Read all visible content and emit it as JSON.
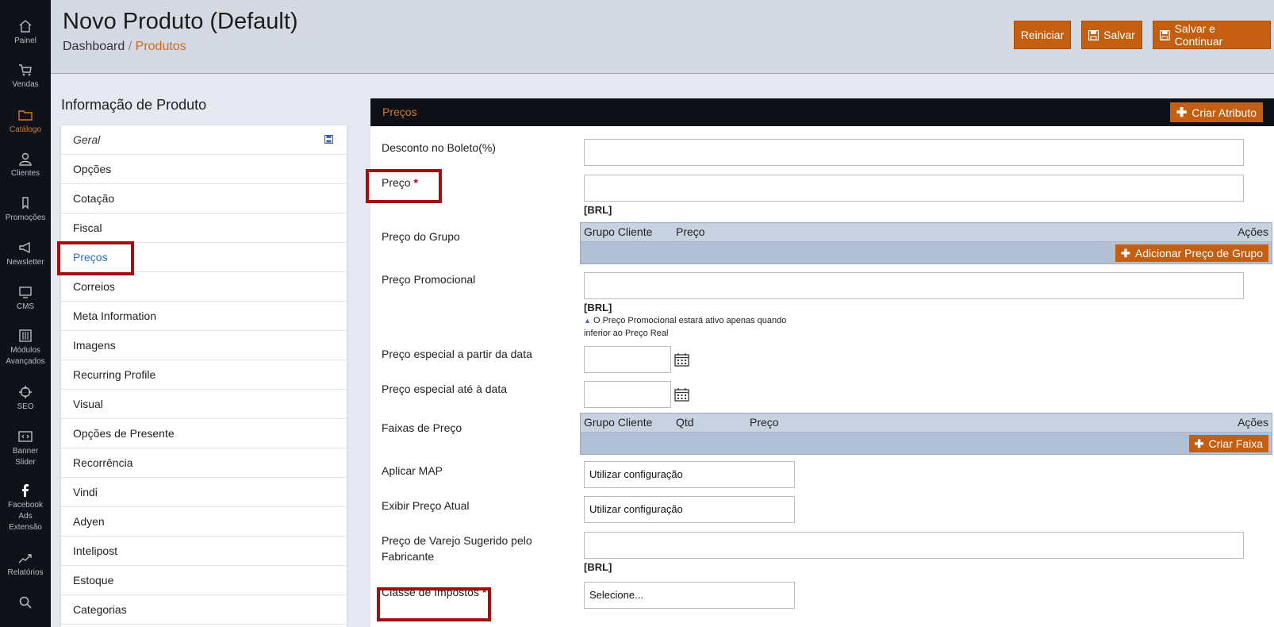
{
  "nav": [
    {
      "label": "Painel",
      "icon": "home-icon"
    },
    {
      "label": "Vendas",
      "icon": "cart-icon"
    },
    {
      "label": "Catálogo",
      "icon": "folder-icon",
      "active": true
    },
    {
      "label": "Clientes",
      "icon": "user-icon"
    },
    {
      "label": "Promoções",
      "icon": "tag-icon"
    },
    {
      "label": "Newsletter",
      "icon": "megaphone-icon"
    },
    {
      "label": "CMS",
      "icon": "monitor-icon"
    },
    {
      "label": "Módulos Avançados",
      "icon": "sliders-icon"
    },
    {
      "label": "SEO",
      "icon": "crosshair-icon"
    },
    {
      "label": "Banner Slider",
      "icon": "code-icon"
    },
    {
      "label": "Facebook Ads Extensão",
      "icon": "facebook-icon"
    },
    {
      "label": "Relatórios",
      "icon": "chart-icon"
    },
    {
      "label": "",
      "icon": "search-icon"
    }
  ],
  "header": {
    "title": "Novo Produto (Default)",
    "breadcrumb_home": "Dashboard",
    "breadcrumb_sep": "/",
    "breadcrumb_current": "Produtos",
    "reset_label": "Reiniciar",
    "save_label": "Salvar",
    "save_continue_label": "Salvar e Continuar"
  },
  "sidebar": {
    "title": "Informação de Produto",
    "tabs": [
      "Geral",
      "Opções",
      "Cotação",
      "Fiscal",
      "Preços",
      "Correios",
      "Meta Information",
      "Imagens",
      "Recurring Profile",
      "Visual",
      "Opções de Presente",
      "Recorrência",
      "Vindi",
      "Adyen",
      "Intelipost",
      "Estoque",
      "Categorias"
    ],
    "active_tab": "Preços"
  },
  "main": {
    "section_title": "Preços",
    "create_attribute_label": "Criar Atributo",
    "currency": "[BRL]",
    "fields": {
      "boleto_discount": {
        "label": "Desconto no Boleto(%)",
        "value": ""
      },
      "price": {
        "label": "Preço",
        "required": "*",
        "value": ""
      },
      "group_price": {
        "label": "Preço do Grupo",
        "col_group": "Grupo Cliente",
        "col_price": "Preço",
        "col_actions": "Ações",
        "add_label": "Adicionar Preço de Grupo"
      },
      "special_price": {
        "label": "Preço Promocional",
        "value": "",
        "note": "O Preço Promocional estará ativo apenas quando inferior ao Preço Real"
      },
      "special_from": {
        "label": "Preço especial a partir da data",
        "value": ""
      },
      "special_to": {
        "label": "Preço especial até à data",
        "value": ""
      },
      "tier_price": {
        "label": "Faixas de Preço",
        "col_group": "Grupo Cliente",
        "col_qty": "Qtd",
        "col_price": "Preço",
        "col_actions": "Ações",
        "add_label": "Criar Faixa"
      },
      "apply_map": {
        "label": "Aplicar MAP",
        "value": "Utilizar configuração"
      },
      "show_price": {
        "label": "Exibir Preço Atual",
        "value": "Utilizar configuração"
      },
      "msrp": {
        "label": "Preço de Varejo Sugerido pelo Fabricante",
        "value": ""
      },
      "tax_class": {
        "label": "Classe de Impostos",
        "required": "*",
        "value": "Selecione..."
      }
    }
  },
  "colors": {
    "accent": "#c45e10",
    "highlight": "#a10f11",
    "nav_bg": "#0f1219",
    "link_active": "#2b6cc4"
  }
}
